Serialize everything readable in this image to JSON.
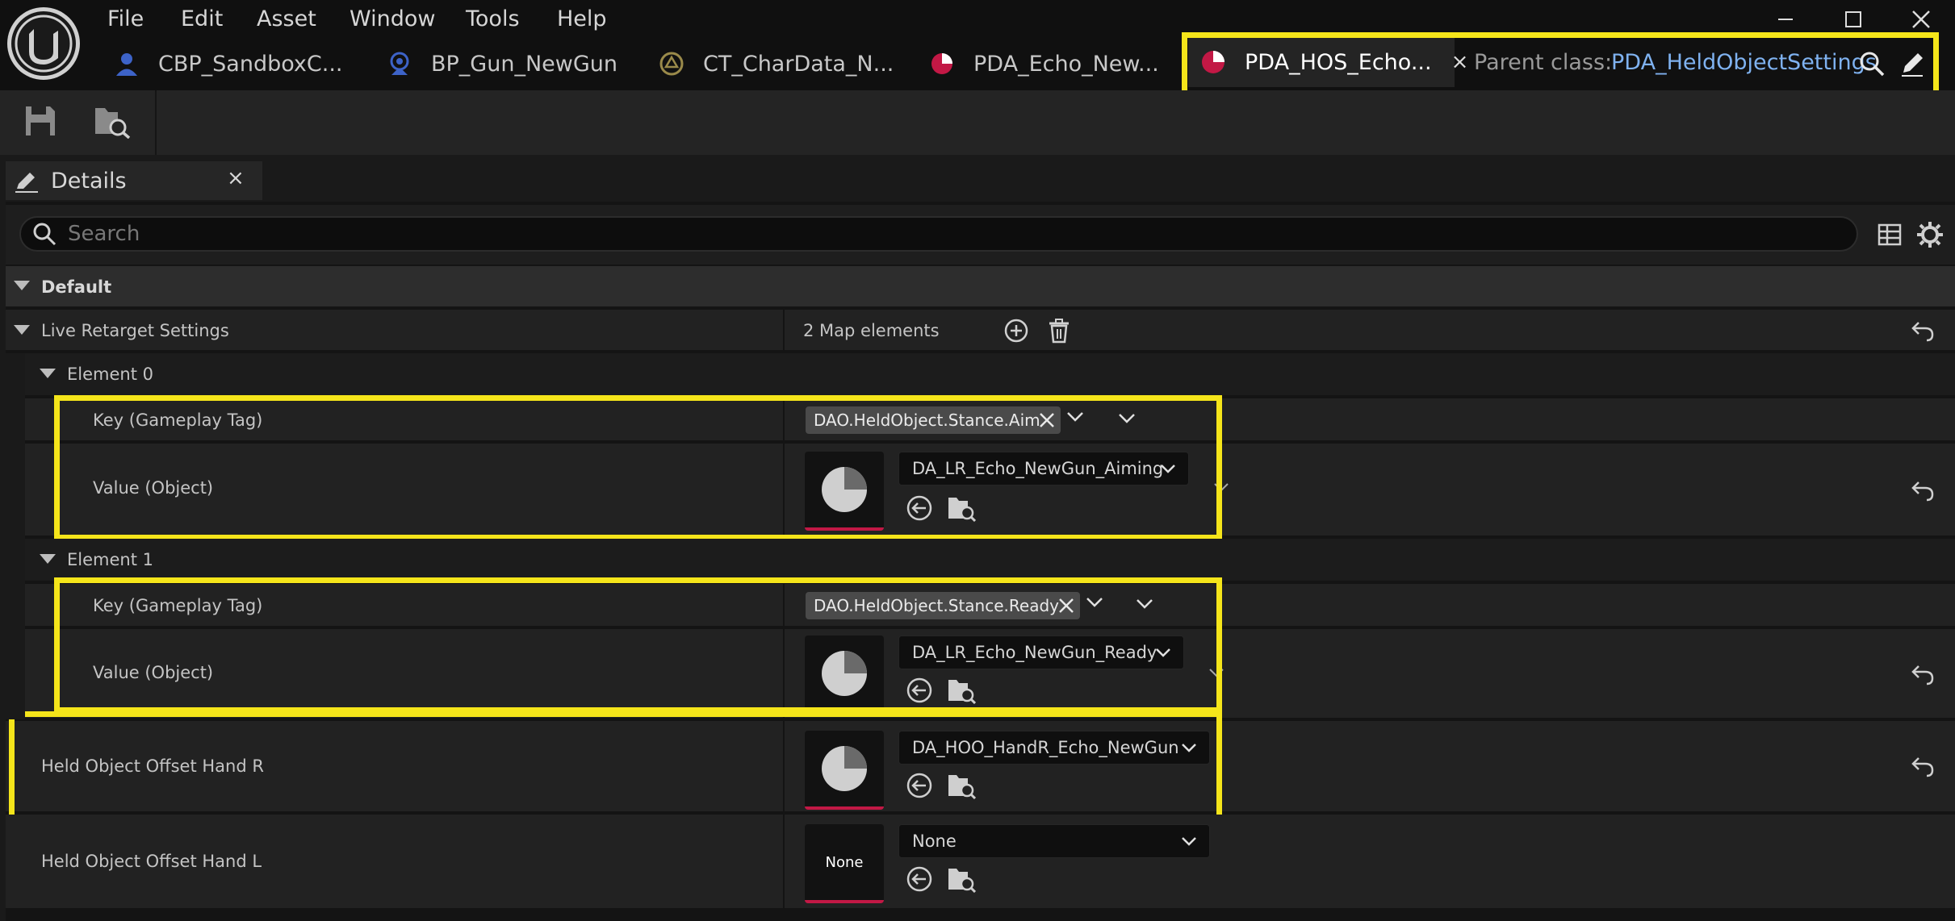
{
  "menu": [
    "File",
    "Edit",
    "Asset",
    "Window",
    "Tools",
    "Help"
  ],
  "tabs": [
    {
      "label": "CBP_SandboxC..."
    },
    {
      "label": "BP_Gun_NewGun"
    },
    {
      "label": "CT_CharData_N..."
    },
    {
      "label": "PDA_Echo_New..."
    }
  ],
  "active_tab": {
    "label": "PDA_HOS_Echo...",
    "close": "×"
  },
  "parent_class": {
    "label": "Parent class:",
    "value": "PDA_HeldObjectSettings"
  },
  "details": {
    "title": "Details",
    "close": "×",
    "search_placeholder": "Search",
    "default_category": "Default",
    "live_retarget": {
      "label": "Live Retarget Settings",
      "count": "2 Map elements"
    },
    "elements": [
      {
        "label": "Element 0",
        "key_label": "Key (Gameplay Tag)",
        "tag": "DAO.HeldObject.Stance.Aim",
        "value_label": "Value (Object)",
        "asset": "DA_LR_Echo_NewGun_Aiming"
      },
      {
        "label": "Element 1",
        "key_label": "Key (Gameplay Tag)",
        "tag": "DAO.HeldObject.Stance.Ready",
        "value_label": "Value (Object)",
        "asset": "DA_LR_Echo_NewGun_Ready"
      }
    ],
    "hand_r": {
      "label": "Held Object Offset Hand R",
      "asset": "DA_HOO_HandR_Echo_NewGun"
    },
    "hand_l": {
      "label": "Held Object Offset Hand L",
      "asset": "None",
      "thumb_text": "None"
    }
  },
  "colors": {
    "highlight": "#f5e51a",
    "accent_link": "#7fb2f0",
    "asset_underline": "#c21845"
  }
}
